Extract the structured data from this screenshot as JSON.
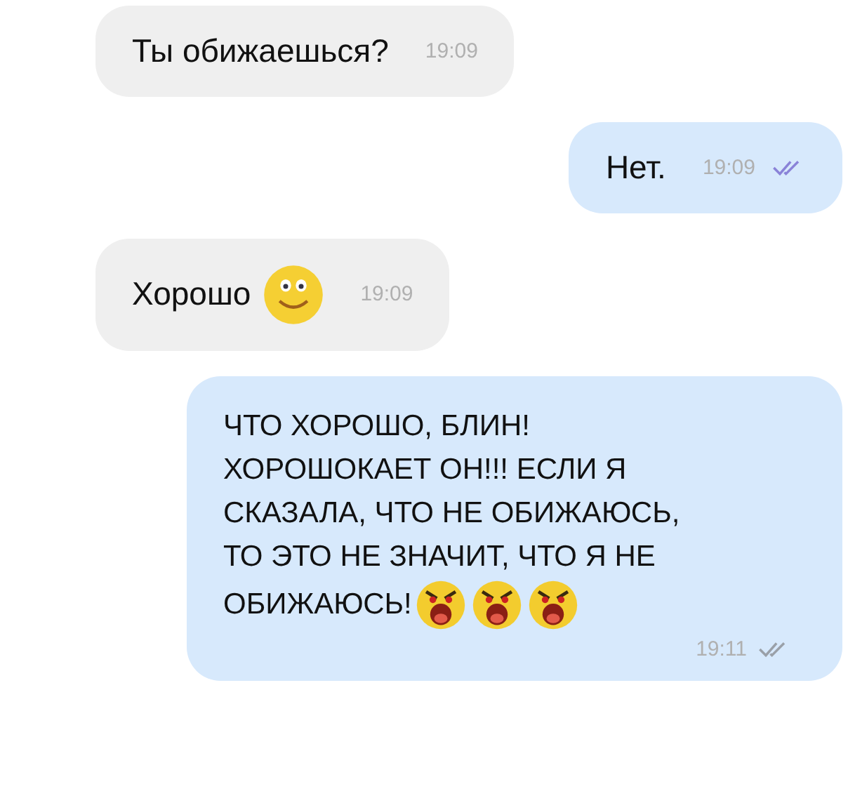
{
  "messages": [
    {
      "outgoing": false,
      "text": "Ты обижаешься?",
      "time": "19:09"
    },
    {
      "outgoing": true,
      "text": "Нет.",
      "time": "19:09",
      "read": true
    },
    {
      "outgoing": false,
      "text": "Хорошо",
      "time": "19:09",
      "emojis": [
        {
          "kind": "smile"
        }
      ]
    },
    {
      "outgoing": true,
      "lines": [
        "ЧТО ХОРОШО, БЛИН!",
        "ХОРОШОКАЕТ ОН!!! ЕСЛИ Я",
        "СКАЗАЛА, ЧТО НЕ ОБИЖАЮСЬ,",
        "ТО ЭТО НЕ ЗНАЧИТ, ЧТО Я НЕ",
        "ОБИЖАЮСЬ!"
      ],
      "time": "19:11",
      "read": false,
      "emojis": [
        {
          "kind": "angry"
        },
        {
          "kind": "angry"
        },
        {
          "kind": "angry"
        }
      ]
    }
  ]
}
